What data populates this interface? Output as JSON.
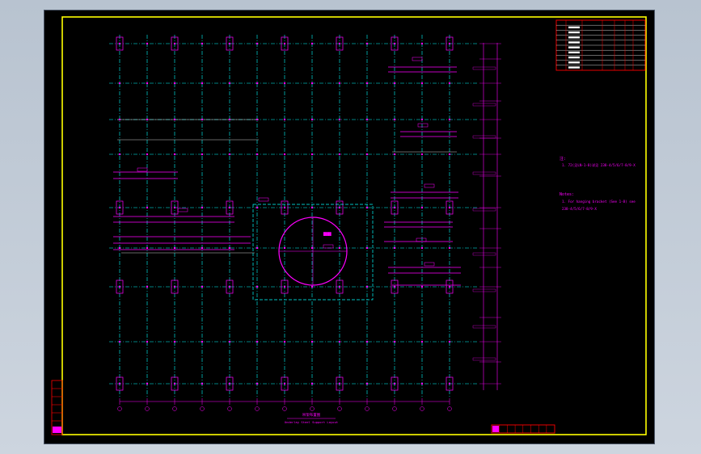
{
  "drawing": {
    "notes_heading_cn": "注:",
    "note_cn": "1. 72(见LN-1-8)详见 238-4/5/6/7-8/9-X",
    "notes_heading_en": "Notes:",
    "note_en_line1": "1. For hanging bracket (See 1-8) see",
    "note_en_line2": "238-4/5/6/7-8/9-X",
    "plan_title_cn": "吊架布置图",
    "plan_title_en": "Underlay Steel Support Layout"
  },
  "colors": {
    "border": "#ffff00",
    "grid": "#00ffff",
    "steel": "#ff00ff",
    "title_block": "#ff0000",
    "annotation": "#ffffff"
  }
}
